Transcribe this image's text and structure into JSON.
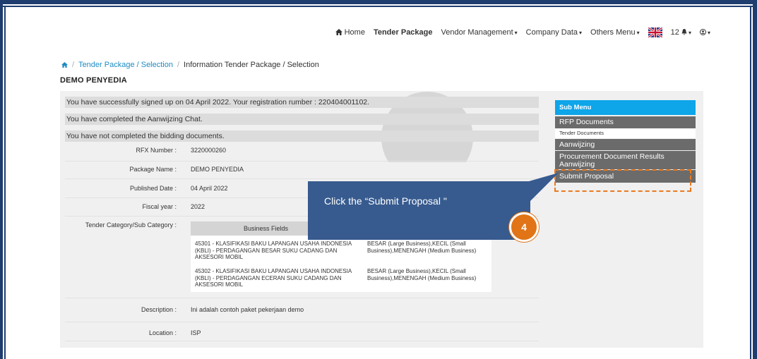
{
  "topnav": {
    "home_icon": "home-icon",
    "home": "Home",
    "tender_package": "Tender Package",
    "vendor_management": "Vendor Management",
    "company_data": "Company Data",
    "others_menu": "Others Menu",
    "notif_count": "12",
    "caret": "▾"
  },
  "breadcrumb": {
    "home_icon": "home-icon",
    "link": "Tender Package / Selection",
    "current": "Information Tender Package / Selection"
  },
  "company": "DEMO PENYEDIA",
  "notices": [
    "You have successfully signed up on 04 April 2022. Your registration rumber : 220404001102.",
    "You have completed the Aanwijzing Chat.",
    "You have not completed the bidding documents."
  ],
  "details": {
    "rfx_label": "RFX Number :",
    "rfx_value": "3220000260",
    "package_label": "Package Name :",
    "package_value": "DEMO PENYEDIA",
    "published_label": "Published Date :",
    "published_value": "04 April 2022",
    "fiscal_label": "Fiscal year :",
    "fiscal_value": "2022",
    "category_label": "Tender Category/Sub Category :",
    "description_label": "Description :",
    "description_value": "Ini adalah contoh paket pekerjaan demo",
    "location_label": "Location :",
    "location_value": "ISP"
  },
  "business": {
    "header": "Business Fields",
    "rows": [
      {
        "field": "45301 - KLASIFIKASI BAKU LAPANGAN USAHA INDONESIA (KBLI) - PERDAGANGAN BESAR SUKU CADANG DAN AKSESORI MOBIL",
        "category": "BESAR (Large Business),KECIL (Small Business),MENENGAH (Medium Business)"
      },
      {
        "field": "45302 - KLASIFIKASI BAKU LAPANGAN USAHA INDONESIA (KBLI) - PERDAGANGAN ECERAN SUKU CADANG DAN AKSESORI MOBIL",
        "category": "BESAR (Large Business),KECIL (Small Business),MENENGAH (Medium Business)"
      }
    ]
  },
  "submenu": {
    "title": "Sub Menu",
    "rfp": "RFP Documents",
    "tender_docs": "Tender Documents",
    "aanwijzing": "Aanwijzing",
    "procurement": "Procurement Document Results Aanwijzing",
    "submit": "Submit Proposal"
  },
  "callout": {
    "text": "Click the “Submit Proposal \"",
    "step": "4"
  },
  "colors": {
    "accent": "#0ea5e9",
    "callout": "#375b8f",
    "badge": "#e07417",
    "link": "#1e8bc3"
  }
}
